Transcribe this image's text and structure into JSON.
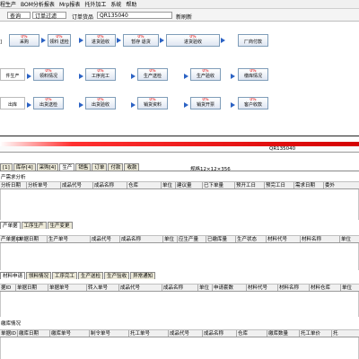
{
  "menu": [
    "程生产",
    "BOM分析报表",
    "Mrp报表",
    "托外加工",
    "系统",
    "帮助"
  ],
  "toolbar": {
    "query": "查询",
    "filter": "订单过滤",
    "order_label": "订单货品",
    "order_no": "QR135040",
    "refresh": "新刷新"
  },
  "flow": {
    "row1": [
      {
        "pct": "0%",
        "label": "采购"
      },
      {
        "pct": "0%",
        "label": "领料 送检"
      },
      {
        "pct": "0%",
        "label": "进货验收"
      },
      {
        "pct": "0%",
        "label": "暂存 退货"
      },
      {
        "pct": "0%",
        "label": "进货验收"
      },
      {
        "pct": "",
        "label": "厂商付款"
      }
    ],
    "row2": [
      {
        "pct": "",
        "label": "件生产"
      },
      {
        "pct": "0%",
        "label": "领料情况"
      },
      {
        "pct": "0%",
        "label": "工序完工"
      },
      {
        "pct": "0%",
        "label": "生产送检"
      },
      {
        "pct": "0%",
        "label": "生产验收"
      },
      {
        "pct": "0%",
        "label": "缴库情况"
      }
    ],
    "row3": [
      {
        "pct": "",
        "label": "出库"
      },
      {
        "pct": "0%",
        "label": "出货送检"
      },
      {
        "pct": "0%",
        "label": "出货验收"
      },
      {
        "pct": "0%",
        "label": "销货资料"
      },
      {
        "pct": "0%",
        "label": "销货开票"
      },
      {
        "pct": "0%",
        "label": "客户收款"
      }
    ]
  },
  "status_order": "QR135040",
  "main_tabs": [
    "[1]",
    "库存[4]",
    "采购[4]",
    "生产",
    "销售",
    "订单",
    "付款",
    "收款"
  ],
  "spec": "规格12×12×356",
  "section1": {
    "title": "产需求分析",
    "cols": [
      "分析日期",
      "分析单号",
      "成品代号",
      "成品名称",
      "仓库",
      "单位",
      "建议量",
      "已下单量",
      "预开工日",
      "预完工日",
      "需求日期",
      "委外"
    ]
  },
  "section2": {
    "tabs": [
      "产单据",
      "工序生产",
      "生产变更"
    ],
    "cols": [
      "产单据ID",
      "单据日期",
      "生产单号",
      "成品代号",
      "成品名称",
      "单位",
      "应生产量",
      "已缴库量",
      "生产状态",
      "材料代号",
      "材料名称",
      "单位"
    ]
  },
  "section3": {
    "tabs": [
      "材料申请",
      "领料情况",
      "工序完工",
      "生产送检",
      "生产验收",
      "异常通知"
    ],
    "cols": [
      "据ID",
      "单据日期",
      "单据单号",
      "转入单号",
      "成品代号",
      "成品名称",
      "单位",
      "申请套数",
      "材料代号",
      "材料名称",
      "材料仓库",
      "单位"
    ]
  },
  "section4": {
    "title": "缴库情况",
    "cols": [
      "单据ID",
      "缴库日期",
      "缴库单号",
      "制令单号",
      "托工单号",
      "成品代号",
      "成品名称",
      "仓库",
      "缴库数量",
      "托工单价",
      "托"
    ]
  }
}
